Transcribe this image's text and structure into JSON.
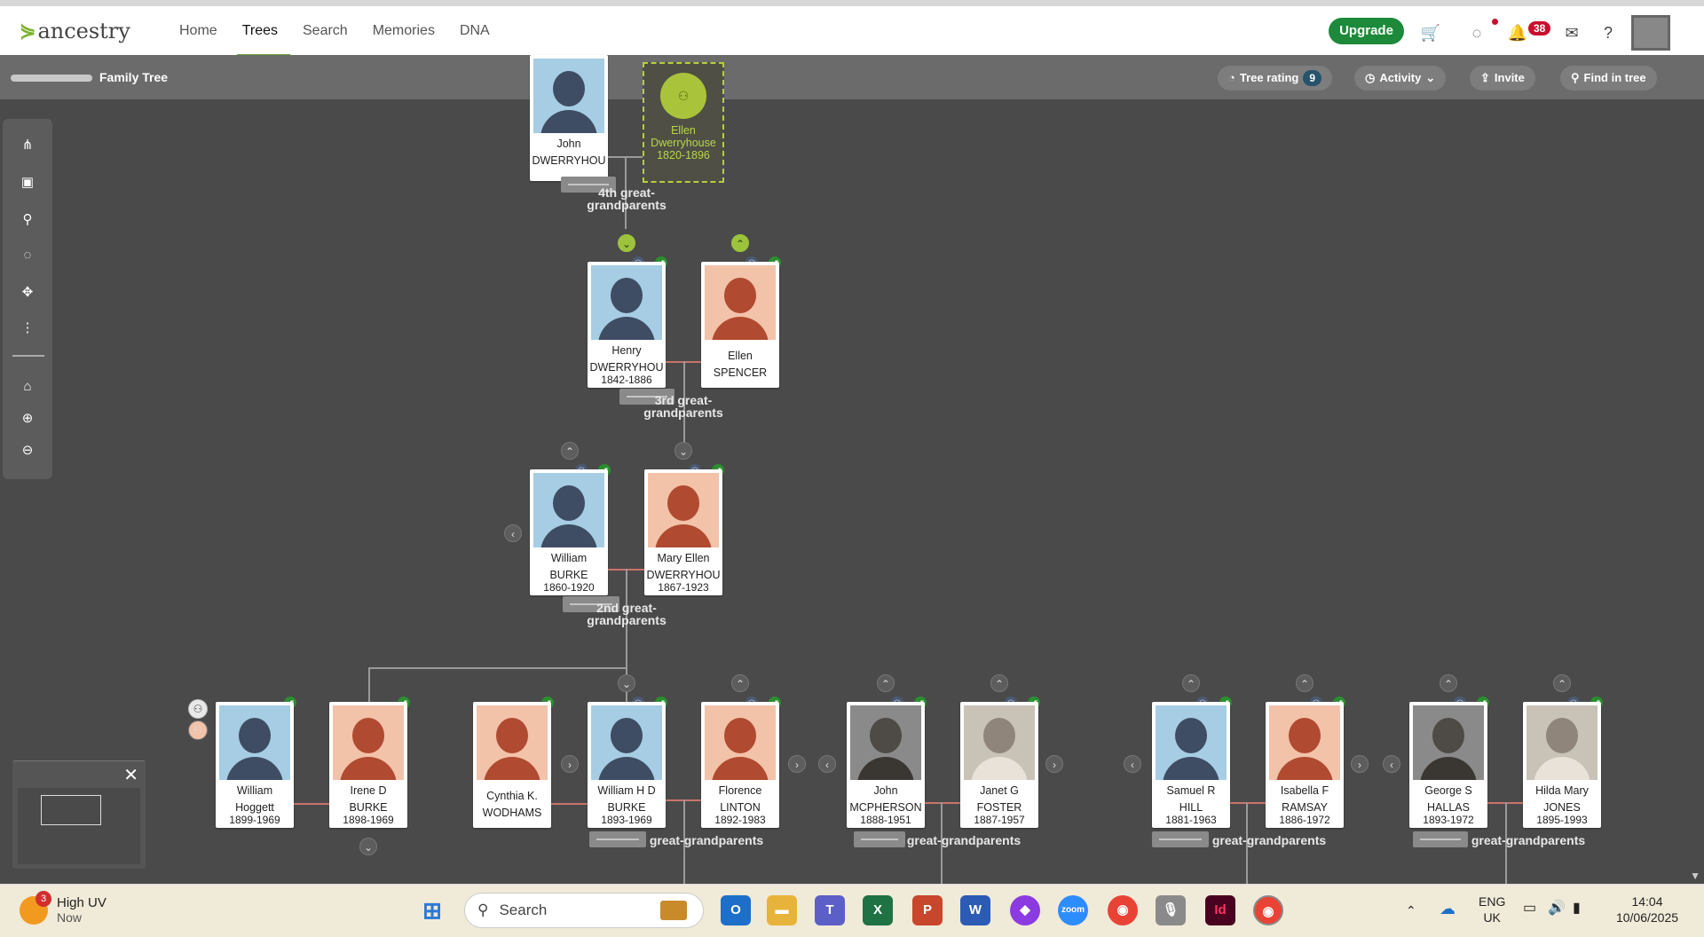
{
  "header": {
    "logo": "ancestry",
    "nav": [
      "Home",
      "Trees",
      "Search",
      "Memories",
      "DNA"
    ],
    "active_nav": "Trees",
    "upgrade": "Upgrade",
    "notifications": "38"
  },
  "subbar": {
    "tree_name": "Family Tree",
    "tree_rating_label": "Tree rating",
    "tree_rating_value": "9",
    "activity": "Activity",
    "invite": "Invite",
    "find": "Find in tree"
  },
  "generations": {
    "g4": "4th great-grandparents",
    "g3": "3rd great-grandparents",
    "g2": "2nd great-grandparents",
    "g1": "great-grandparents"
  },
  "people": {
    "john_d": {
      "first": "John",
      "last": "DWERRYHOU",
      "years": ""
    },
    "ellen_d": {
      "first": "Ellen",
      "last": "Dwerryhouse",
      "years": "1820-1896"
    },
    "henry": {
      "first": "Henry",
      "last": "DWERRYHOU",
      "years": "1842-1886"
    },
    "ellen_s": {
      "first": "Ellen",
      "last": "SPENCER",
      "years": ""
    },
    "william_b": {
      "first": "William",
      "last": "BURKE",
      "years": "1860-1920"
    },
    "mary_ellen": {
      "first": "Mary Ellen",
      "last": "DWERRYHOU",
      "years": "1867-1923"
    },
    "william_h": {
      "first": "William",
      "last": "Hoggett",
      "years": "1899-1969"
    },
    "irene": {
      "first": "Irene D",
      "last": "BURKE",
      "years": "1898-1969"
    },
    "cynthia": {
      "first": "Cynthia K.",
      "last": "WODHAMS",
      "years": ""
    },
    "william_hd": {
      "first": "William H D",
      "last": "BURKE",
      "years": "1893-1969"
    },
    "florence": {
      "first": "Florence",
      "last": "LINTON",
      "years": "1892-1983"
    },
    "john_m": {
      "first": "John",
      "last": "MCPHERSON",
      "years": "1888-1951"
    },
    "janet": {
      "first": "Janet G",
      "last": "FOSTER",
      "years": "1887-1957"
    },
    "samuel": {
      "first": "Samuel R",
      "last": "HILL",
      "years": "1881-1963"
    },
    "isabella": {
      "first": "Isabella F",
      "last": "RAMSAY",
      "years": "1886-1972"
    },
    "george": {
      "first": "George S",
      "last": "HALLAS",
      "years": "1893-1972"
    },
    "hilda": {
      "first": "Hilda Mary",
      "last": "JONES",
      "years": "1895-1993"
    }
  },
  "taskbar": {
    "weather_title": "High UV",
    "weather_sub": "Now",
    "weather_badge": "3",
    "search": "Search",
    "lang1": "ENG",
    "lang2": "UK",
    "time": "14:04",
    "date": "10/06/2025"
  },
  "colors": {
    "brand_green": "#1c8a3a",
    "hint_green": "#2a8f2f",
    "canvas": "#4a4a4a",
    "male_bg": "#a6cde3",
    "female_bg": "#f2c2a9"
  }
}
